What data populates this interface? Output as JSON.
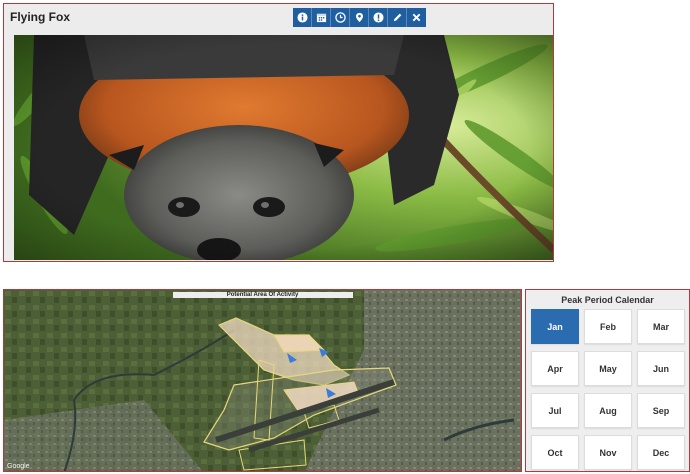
{
  "top_panel": {
    "title": "Flying Fox",
    "toolbar": [
      {
        "icon": "info-icon"
      },
      {
        "icon": "calendar-icon"
      },
      {
        "icon": "clock-icon"
      },
      {
        "icon": "map-pin-icon"
      },
      {
        "icon": "alert-icon"
      },
      {
        "icon": "pencil-icon"
      },
      {
        "icon": "close-icon"
      }
    ],
    "colors": {
      "toolbar_bg": "#1f5f9f",
      "border": "#b23a3a"
    }
  },
  "map_panel": {
    "title": "Potential Area Of Activity",
    "watermark": "Google",
    "colors": {
      "zone_outline": "#e8d77a",
      "zone_fill": "#f3dcc3",
      "marker": "#3d7bd6"
    }
  },
  "calendar": {
    "title": "Peak Period Calendar",
    "selected": "Jan",
    "active_color": "#2b6cb0",
    "months": [
      "Jan",
      "Feb",
      "Mar",
      "Apr",
      "May",
      "Jun",
      "Jul",
      "Aug",
      "Sep",
      "Oct",
      "Nov",
      "Dec"
    ]
  }
}
